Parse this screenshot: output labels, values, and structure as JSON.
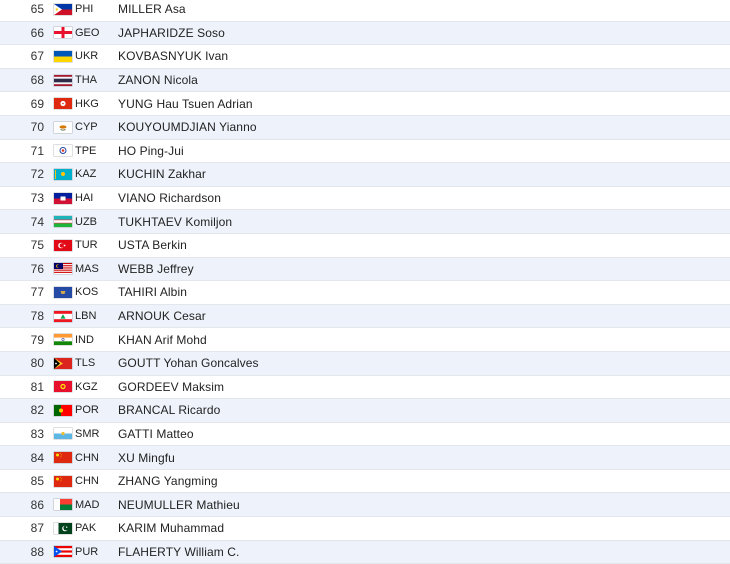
{
  "rows": [
    {
      "rank": "65",
      "code": "PHI",
      "name": "MILLER Asa",
      "flag": "philippines-flag"
    },
    {
      "rank": "66",
      "code": "GEO",
      "name": "JAPHARIDZE Soso",
      "flag": "georgia-flag"
    },
    {
      "rank": "67",
      "code": "UKR",
      "name": "KOVBASNYUK Ivan",
      "flag": "ukraine-flag"
    },
    {
      "rank": "68",
      "code": "THA",
      "name": "ZANON Nicola",
      "flag": "thailand-flag"
    },
    {
      "rank": "69",
      "code": "HKG",
      "name": "YUNG Hau Tsuen Adrian",
      "flag": "hong-kong-flag"
    },
    {
      "rank": "70",
      "code": "CYP",
      "name": "KOUYOUMDJIAN Yianno",
      "flag": "cyprus-flag"
    },
    {
      "rank": "71",
      "code": "TPE",
      "name": "HO Ping-Jui",
      "flag": "chinese-taipei-flag"
    },
    {
      "rank": "72",
      "code": "KAZ",
      "name": "KUCHIN Zakhar",
      "flag": "kazakhstan-flag"
    },
    {
      "rank": "73",
      "code": "HAI",
      "name": "VIANO Richardson",
      "flag": "haiti-flag"
    },
    {
      "rank": "74",
      "code": "UZB",
      "name": "TUKHTAEV Komiljon",
      "flag": "uzbekistan-flag"
    },
    {
      "rank": "75",
      "code": "TUR",
      "name": "USTA Berkin",
      "flag": "turkey-flag"
    },
    {
      "rank": "76",
      "code": "MAS",
      "name": "WEBB Jeffrey",
      "flag": "malaysia-flag"
    },
    {
      "rank": "77",
      "code": "KOS",
      "name": "TAHIRI Albin",
      "flag": "kosovo-flag"
    },
    {
      "rank": "78",
      "code": "LBN",
      "name": "ARNOUK Cesar",
      "flag": "lebanon-flag"
    },
    {
      "rank": "79",
      "code": "IND",
      "name": "KHAN Arif Mohd",
      "flag": "india-flag"
    },
    {
      "rank": "80",
      "code": "TLS",
      "name": "GOUTT Yohan Goncalves",
      "flag": "timor-leste-flag"
    },
    {
      "rank": "81",
      "code": "KGZ",
      "name": "GORDEEV Maksim",
      "flag": "kyrgyzstan-flag"
    },
    {
      "rank": "82",
      "code": "POR",
      "name": "BRANCAL Ricardo",
      "flag": "portugal-flag"
    },
    {
      "rank": "83",
      "code": "SMR",
      "name": "GATTI Matteo",
      "flag": "san-marino-flag"
    },
    {
      "rank": "84",
      "code": "CHN",
      "name": "XU Mingfu",
      "flag": "china-flag"
    },
    {
      "rank": "85",
      "code": "CHN",
      "name": "ZHANG Yangming",
      "flag": "china-flag"
    },
    {
      "rank": "86",
      "code": "MAD",
      "name": "NEUMULLER Mathieu",
      "flag": "madagascar-flag"
    },
    {
      "rank": "87",
      "code": "PAK",
      "name": "KARIM Muhammad",
      "flag": "pakistan-flag"
    },
    {
      "rank": "88",
      "code": "PUR",
      "name": "FLAHERTY William C.",
      "flag": "puerto-rico-flag"
    }
  ]
}
